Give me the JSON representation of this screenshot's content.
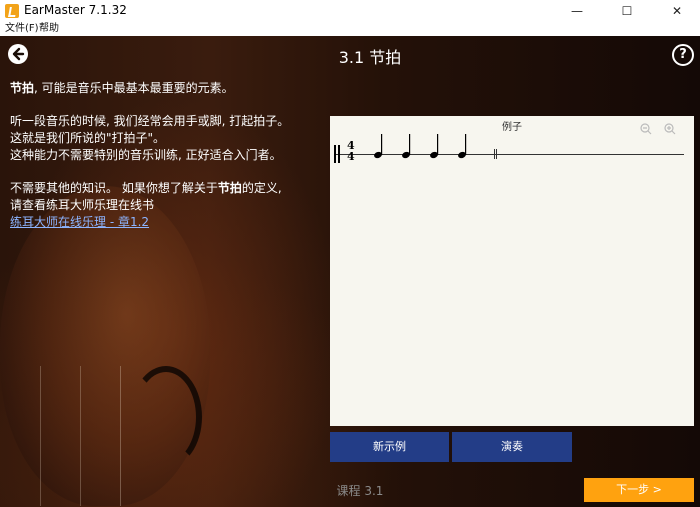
{
  "window": {
    "title": "EarMaster 7.1.32",
    "minimize": "—",
    "maximize": "☐",
    "close": "✕"
  },
  "menu": {
    "file": "文件(F)",
    "help": "帮助"
  },
  "header": {
    "title": "3.1 节拍",
    "help_symbol": "?"
  },
  "content": {
    "p1_bold": "节拍",
    "p1_rest": ", 可能是音乐中最基本最重要的元素。",
    "p2_line1": "听一段音乐的时候, 我们经常会用手或脚, 打起拍子。",
    "p2_line2": "这就是我们所说的\"打拍子\"。",
    "p2_line3": "这种能力不需要特别的音乐训练, 正好适合入门者。",
    "p3_line1_a": "不需要其他的知识。 如果你想了解关于",
    "p3_line1_bold": "节拍",
    "p3_line1_b": "的定义,",
    "p3_line2": "请查看练耳大师乐理在线书",
    "link": "练耳大师在线乐理 - 章1.2"
  },
  "example": {
    "title": "例子",
    "time_signature_top": "4",
    "time_signature_bottom": "4",
    "notes": 4
  },
  "buttons": {
    "new_example": "新示例",
    "play": "演奏",
    "next": "下一步 >"
  },
  "footer": {
    "lesson": "课程 3.1"
  },
  "colors": {
    "button_blue": "#233d87",
    "next_orange": "#ffa20f",
    "link": "#8cb4ff"
  }
}
